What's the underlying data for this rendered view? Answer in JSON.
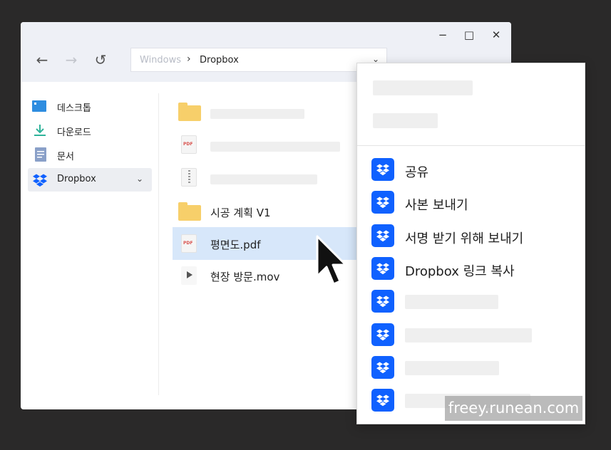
{
  "window": {
    "controls": {
      "minimize": "−",
      "maximize": "□",
      "close": "✕"
    },
    "nav": {
      "back": "←",
      "forward": "→",
      "refresh": "↺"
    },
    "address": {
      "root": "Windows",
      "separator": "›",
      "current": "Dropbox",
      "chevron": "⌄"
    }
  },
  "sidebar": {
    "items": [
      {
        "label": "데스크톱",
        "icon": "desktop-icon"
      },
      {
        "label": "다운로드",
        "icon": "download-icon"
      },
      {
        "label": "문서",
        "icon": "document-icon"
      },
      {
        "label": "Dropbox",
        "icon": "dropbox-icon",
        "active": true,
        "chevron": "⌄"
      }
    ]
  },
  "files": {
    "pdf_tag": "PDF",
    "items": [
      {
        "type": "folder",
        "label": ""
      },
      {
        "type": "pdf",
        "label": ""
      },
      {
        "type": "zip",
        "label": ""
      },
      {
        "type": "folder",
        "label": "시공 계획 V1"
      },
      {
        "type": "pdf",
        "label": "평면도.pdf",
        "selected": true
      },
      {
        "type": "video",
        "label": "현장 방문.mov"
      }
    ]
  },
  "context_menu": {
    "items": [
      {
        "label": "공유"
      },
      {
        "label": "사본 보내기"
      },
      {
        "label": "서명 받기 위해 보내기"
      },
      {
        "label": "Dropbox 링크 복사"
      },
      {
        "label": ""
      },
      {
        "label": ""
      },
      {
        "label": ""
      },
      {
        "label": ""
      }
    ]
  },
  "colors": {
    "dropbox_blue": "#0f61ff",
    "selection": "#d7e7fa",
    "folder": "#f7cf6a",
    "background": "#2a2929"
  },
  "watermark": "freey.runean.com"
}
